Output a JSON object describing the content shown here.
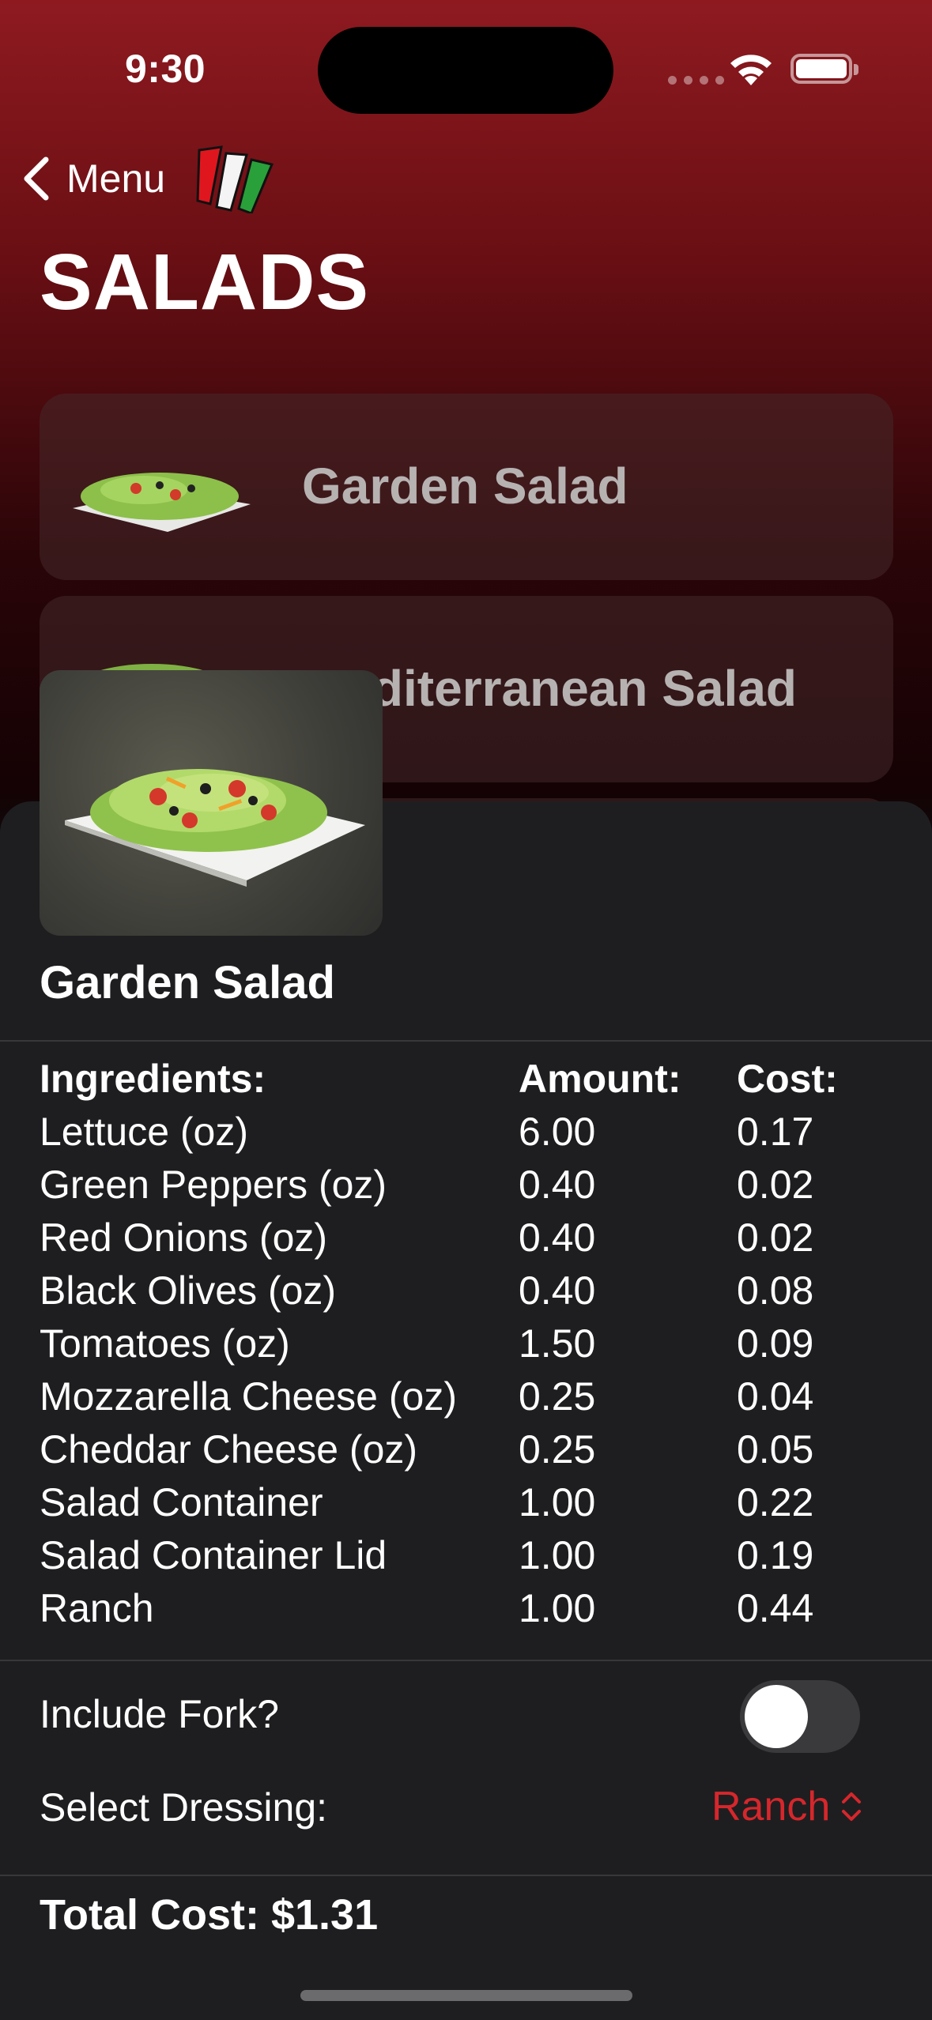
{
  "status": {
    "time": "9:30"
  },
  "nav": {
    "back_label": "Menu",
    "logo": "italian-flag-logo"
  },
  "page": {
    "title": "SALADS"
  },
  "list": [
    {
      "label": "Garden Salad",
      "icon": "salad-thumbnail"
    },
    {
      "label": "Mediterranean Salad",
      "icon": "salad-thumbnail"
    }
  ],
  "sheet": {
    "title": "Garden Salad",
    "headers": {
      "ingredients": "Ingredients:",
      "amount": "Amount:",
      "cost": "Cost:"
    },
    "ingredients": [
      {
        "name": "Lettuce (oz)",
        "amount": "6.00",
        "cost": "0.17"
      },
      {
        "name": "Green Peppers (oz)",
        "amount": "0.40",
        "cost": "0.02"
      },
      {
        "name": "Red Onions (oz)",
        "amount": "0.40",
        "cost": "0.02"
      },
      {
        "name": "Black Olives (oz)",
        "amount": "0.40",
        "cost": "0.08"
      },
      {
        "name": "Tomatoes (oz)",
        "amount": "1.50",
        "cost": "0.09"
      },
      {
        "name": "Mozzarella Cheese (oz)",
        "amount": "0.25",
        "cost": "0.04"
      },
      {
        "name": "Cheddar Cheese (oz)",
        "amount": "0.25",
        "cost": "0.05"
      },
      {
        "name": "Salad Container",
        "amount": "1.00",
        "cost": "0.22"
      },
      {
        "name": "Salad Container Lid",
        "amount": "1.00",
        "cost": "0.19"
      },
      {
        "name": "Ranch",
        "amount": "1.00",
        "cost": "0.44"
      }
    ],
    "fork_label": "Include Fork?",
    "fork_on": false,
    "dressing_label": "Select Dressing:",
    "dressing_value": "Ranch",
    "total": "Total Cost: $1.31"
  },
  "colors": {
    "accent": "#d6272c",
    "sheet_bg": "#1e1e20",
    "header_red": "#8e1a20"
  }
}
